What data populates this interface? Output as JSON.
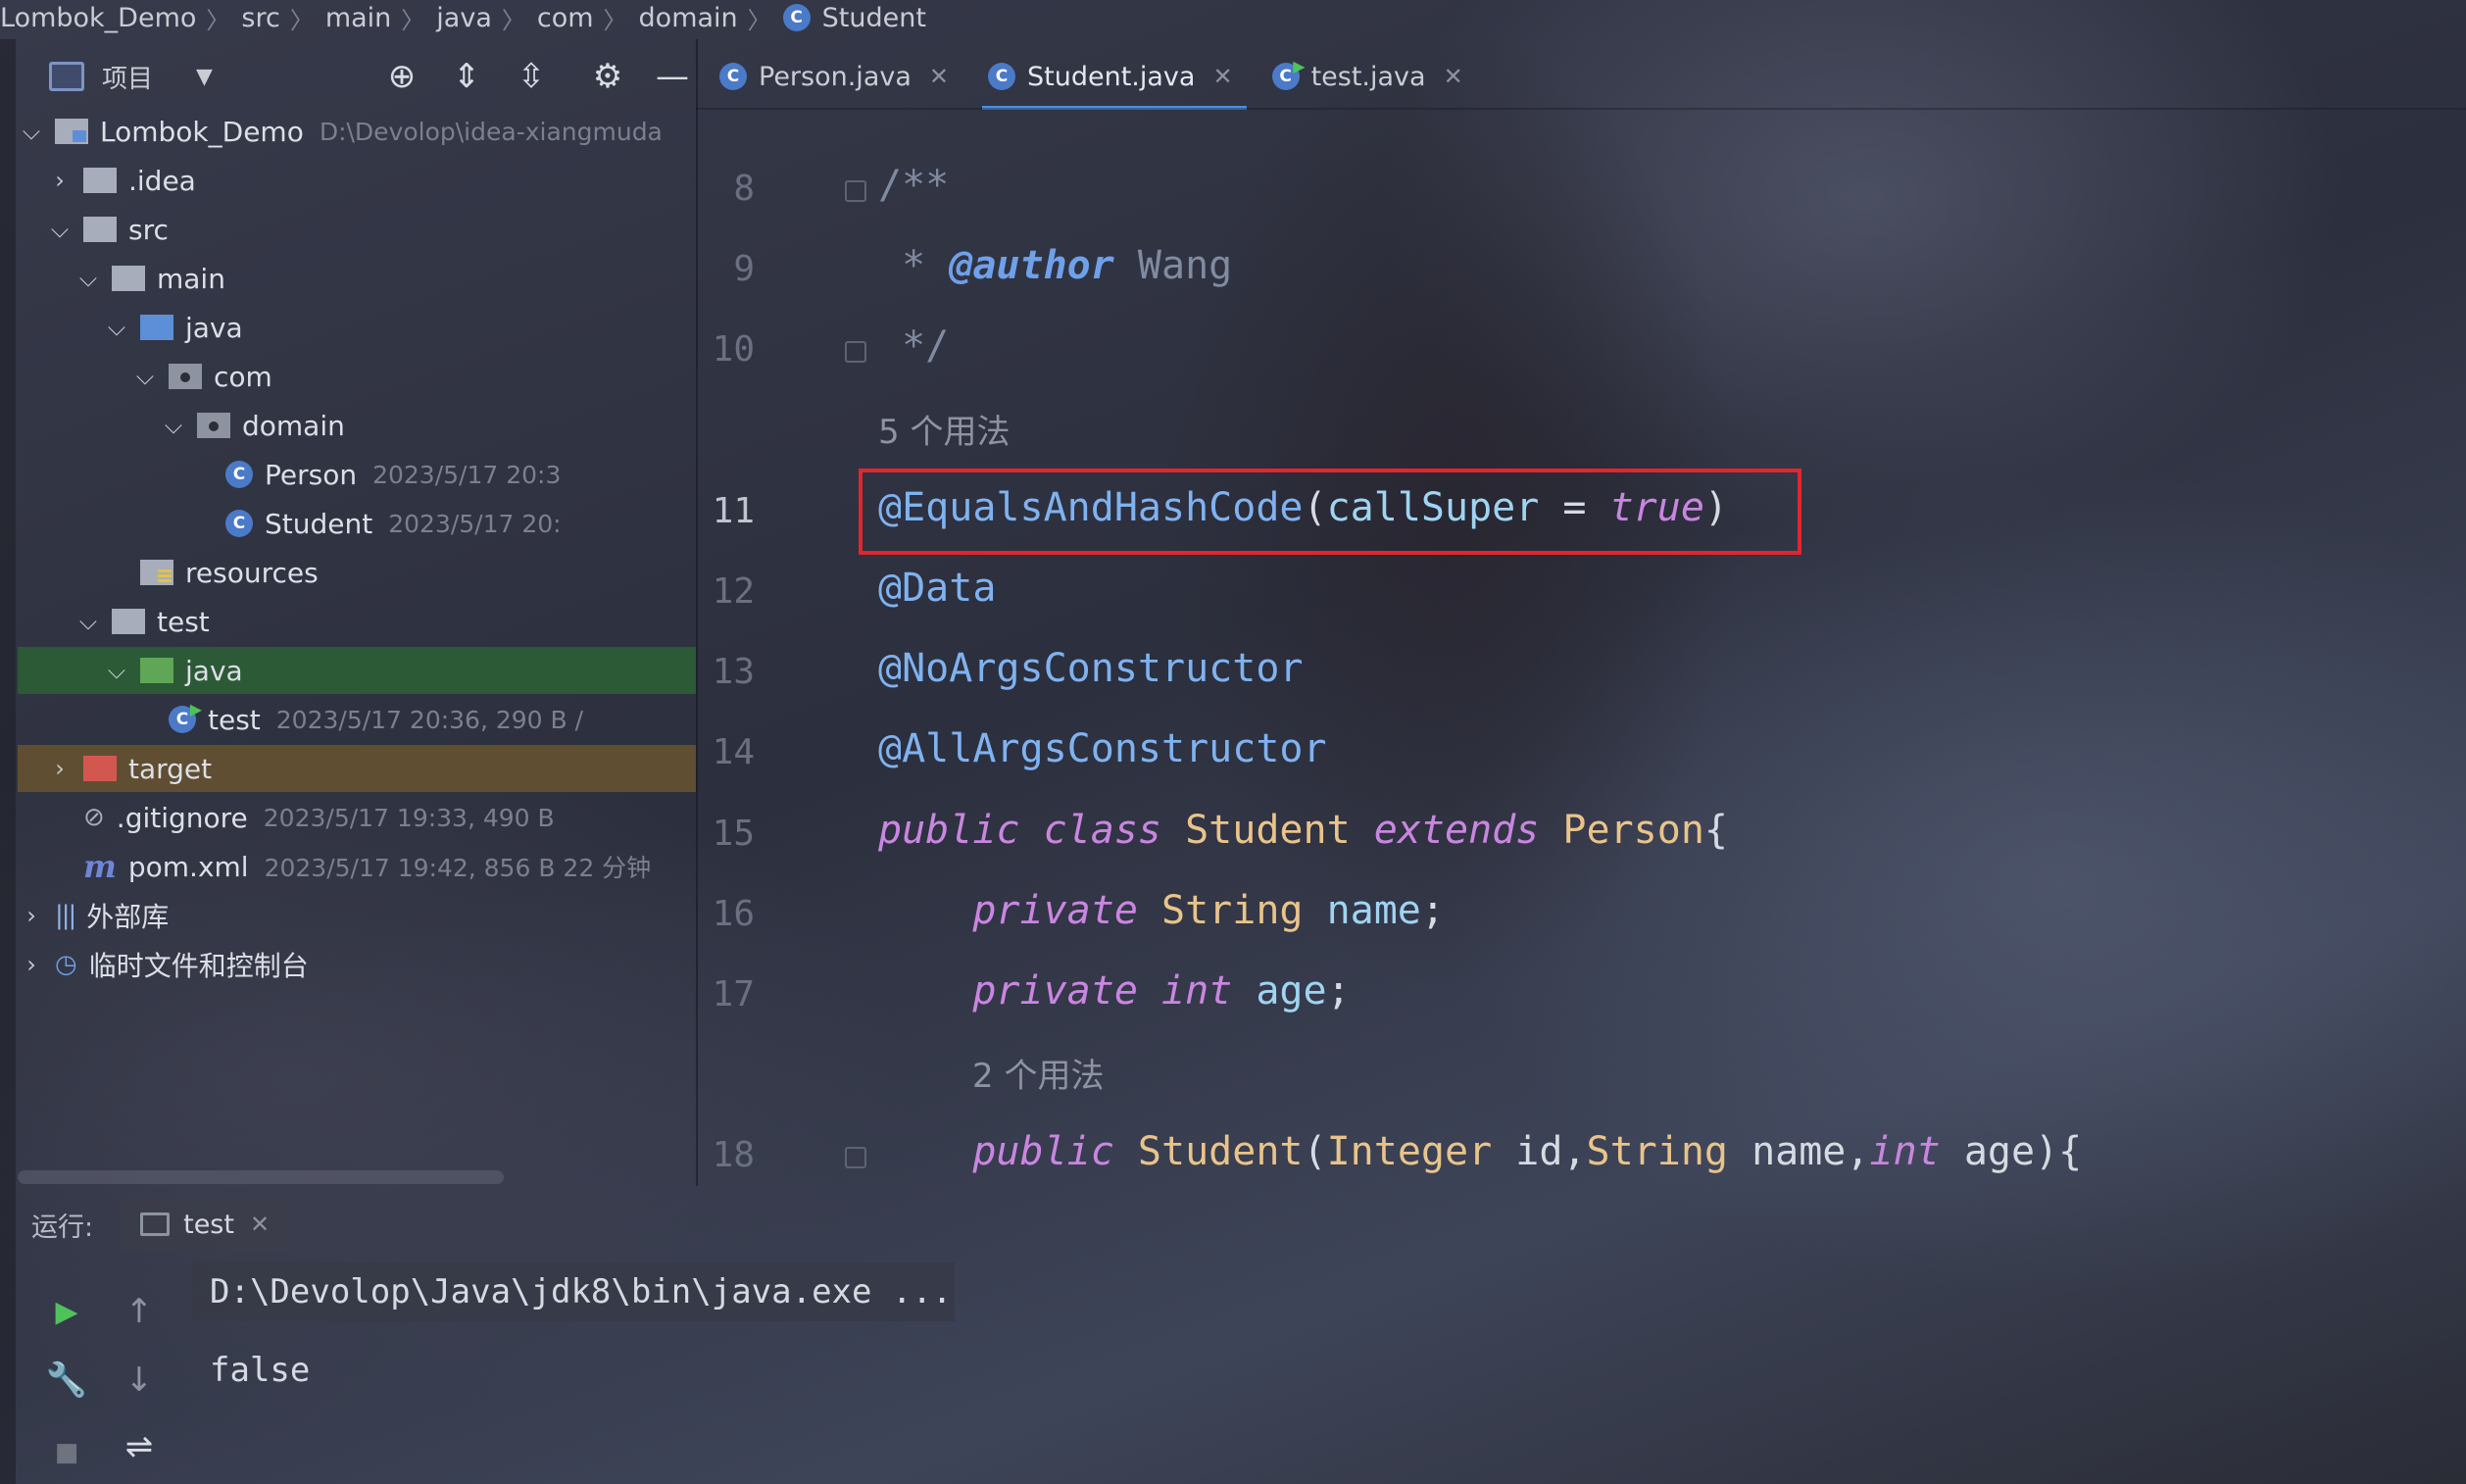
{
  "breadcrumb": [
    {
      "label": "Lombok_Demo"
    },
    {
      "label": "src"
    },
    {
      "label": "main"
    },
    {
      "label": "java"
    },
    {
      "label": "com"
    },
    {
      "label": "domain"
    },
    {
      "label": "Student",
      "icon": "class-icon"
    }
  ],
  "project_toolbar": {
    "label": "项目",
    "icons": [
      "locate-icon",
      "expand-all-icon",
      "collapse-all-icon",
      "gear-icon",
      "hide-icon"
    ]
  },
  "tree": [
    {
      "label": "Lombok_Demo",
      "meta": "D:\\Devolop\\idea-xiangmuda",
      "level": 0,
      "chevron": "down",
      "icon": "module"
    },
    {
      "label": ".idea",
      "meta": "",
      "level": 1,
      "chevron": "right",
      "icon": "folder-gray"
    },
    {
      "label": "src",
      "meta": "",
      "level": 1,
      "chevron": "down",
      "icon": "folder-gray"
    },
    {
      "label": "main",
      "meta": "",
      "level": 2,
      "chevron": "down",
      "icon": "folder-gray"
    },
    {
      "label": "java",
      "meta": "",
      "level": 3,
      "chevron": "down",
      "icon": "folder-blue"
    },
    {
      "label": "com",
      "meta": "",
      "level": 4,
      "chevron": "down",
      "icon": "package"
    },
    {
      "label": "domain",
      "meta": "",
      "level": 5,
      "chevron": "down",
      "icon": "package"
    },
    {
      "label": "Person",
      "meta": "2023/5/17 20:3",
      "level": 6,
      "chevron": "",
      "icon": "class"
    },
    {
      "label": "Student",
      "meta": "2023/5/17 20:",
      "level": 6,
      "chevron": "",
      "icon": "class"
    },
    {
      "label": "resources",
      "meta": "",
      "level": 3,
      "chevron": "",
      "icon": "resources"
    },
    {
      "label": "test",
      "meta": "",
      "level": 2,
      "chevron": "down",
      "icon": "folder-gray"
    },
    {
      "label": "java",
      "meta": "",
      "level": 3,
      "chevron": "down",
      "icon": "folder-green",
      "selected": "green"
    },
    {
      "label": "test",
      "meta": "2023/5/17 20:36, 290 B /",
      "level": 4,
      "chevron": "",
      "icon": "test-class"
    },
    {
      "label": "target",
      "meta": "",
      "level": 1,
      "chevron": "right",
      "icon": "folder-red",
      "selected": "amber"
    },
    {
      "label": ".gitignore",
      "meta": "2023/5/17 19:33, 490 B",
      "level": 1,
      "chevron": "",
      "icon": "gitignore"
    },
    {
      "label": "pom.xml",
      "meta": "2023/5/17 19:42, 856 B 22 分钟",
      "level": 1,
      "chevron": "",
      "icon": "maven"
    },
    {
      "label": "外部库",
      "meta": "",
      "level": 0,
      "chevron": "right",
      "icon": "libraries"
    },
    {
      "label": "临时文件和控制台",
      "meta": "",
      "level": 0,
      "chevron": "right",
      "icon": "scratches"
    }
  ],
  "tabs": [
    {
      "label": "Person.java",
      "active": false,
      "icon": "class-icon"
    },
    {
      "label": "Student.java",
      "active": true,
      "icon": "class-icon"
    },
    {
      "label": "test.java",
      "active": false,
      "icon": "test-class-icon"
    }
  ],
  "editor": {
    "lines": [
      {
        "ln": "8",
        "tokens": [
          [
            "c-comment",
            "/**"
          ]
        ]
      },
      {
        "ln": "9",
        "tokens": [
          [
            "c-comment",
            " * "
          ],
          [
            "c-tag",
            "@author"
          ],
          [
            "c-comment",
            " Wang"
          ]
        ]
      },
      {
        "ln": "10",
        "tokens": [
          [
            "c-comment",
            " */"
          ]
        ]
      },
      {
        "ln": "",
        "hint": "5 个用法"
      },
      {
        "ln": "11",
        "current": true,
        "tokens": [
          [
            "c-ann",
            "@EqualsAndHashCode"
          ],
          [
            "c-punct",
            "("
          ],
          [
            "c-field",
            "callSuper"
          ],
          [
            "c-plain",
            " = "
          ],
          [
            "c-kw",
            "true"
          ],
          [
            "c-punct",
            ")"
          ]
        ]
      },
      {
        "ln": "12",
        "tokens": [
          [
            "c-ann",
            "@Data"
          ]
        ]
      },
      {
        "ln": "13",
        "tokens": [
          [
            "c-ann",
            "@NoArgsConstructor"
          ]
        ]
      },
      {
        "ln": "14",
        "tokens": [
          [
            "c-ann",
            "@AllArgsConstructor"
          ]
        ]
      },
      {
        "ln": "15",
        "tokens": [
          [
            "c-kw",
            "public class "
          ],
          [
            "c-type",
            "Student"
          ],
          [
            "c-kw",
            " extends "
          ],
          [
            "c-type",
            "Person"
          ],
          [
            "c-punct",
            "{"
          ]
        ]
      },
      {
        "ln": "16",
        "tokens": [
          [
            "c-plain",
            "    "
          ],
          [
            "c-kw",
            "private "
          ],
          [
            "c-type",
            "String "
          ],
          [
            "c-field",
            "name"
          ],
          [
            "c-punct",
            ";"
          ]
        ]
      },
      {
        "ln": "17",
        "tokens": [
          [
            "c-plain",
            "    "
          ],
          [
            "c-kw",
            "private int "
          ],
          [
            "c-field",
            "age"
          ],
          [
            "c-punct",
            ";"
          ]
        ]
      },
      {
        "ln": "",
        "hint": "2 个用法",
        "indent": true
      },
      {
        "ln": "18",
        "tokens": [
          [
            "c-plain",
            "    "
          ],
          [
            "c-kw",
            "public "
          ],
          [
            "c-type",
            "Student"
          ],
          [
            "c-punct",
            "("
          ],
          [
            "c-type",
            "Integer "
          ],
          [
            "c-plain",
            "id,"
          ],
          [
            "c-type",
            "String "
          ],
          [
            "c-plain",
            "name,"
          ],
          [
            "c-kw",
            "int "
          ],
          [
            "c-plain",
            "age"
          ],
          [
            "c-punct",
            "){"
          ]
        ]
      }
    ]
  },
  "run": {
    "label": "运行:",
    "tab_label": "test",
    "console_lines": [
      "D:\\Devolop\\Java\\jdk8\\bin\\java.exe ...",
      "false"
    ]
  },
  "colors": {
    "accent": "#4b8ee0",
    "highlight_box": "#e0262f",
    "selected_green": "#2c5c36",
    "selected_amber": "#685430"
  }
}
